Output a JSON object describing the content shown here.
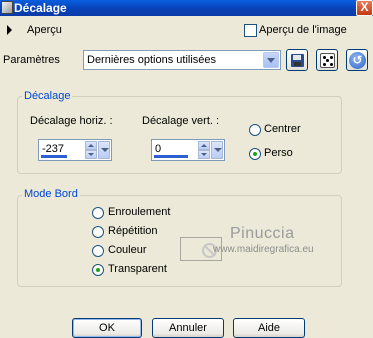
{
  "window": {
    "title": "Décalage",
    "close_label": "X"
  },
  "preview": {
    "label": "Aperçu",
    "image_preview_label": "Aperçu de l'image",
    "image_preview_checked": false
  },
  "parameters": {
    "label": "Paramètres",
    "selected": "Dernières options utilisées"
  },
  "toolbar": {
    "icons": [
      "save-icon",
      "random-dice-icon",
      "reset-icon"
    ]
  },
  "offset_group": {
    "legend": "Décalage",
    "horizontal_label": "Décalage horiz. :",
    "horizontal_value": "-237",
    "vertical_label": "Décalage vert. :",
    "vertical_value": "0",
    "options": [
      {
        "label": "Centrer",
        "selected": false
      },
      {
        "label": "Perso",
        "selected": true
      }
    ]
  },
  "edge_group": {
    "legend": "Mode Bord",
    "options": [
      {
        "label": "Enroulement",
        "selected": false
      },
      {
        "label": "Répétition",
        "selected": false
      },
      {
        "label": "Couleur",
        "selected": false
      },
      {
        "label": "Transparent",
        "selected": true
      }
    ]
  },
  "watermark": {
    "title": "Pinuccia",
    "url": "www.maidiregrafica.eu"
  },
  "buttons": {
    "ok": "OK",
    "cancel": "Annuler",
    "help": "Aide"
  },
  "colors": {
    "accent": "#0046d5",
    "titlebar": "#0842b8",
    "background": "#ece9d8"
  }
}
